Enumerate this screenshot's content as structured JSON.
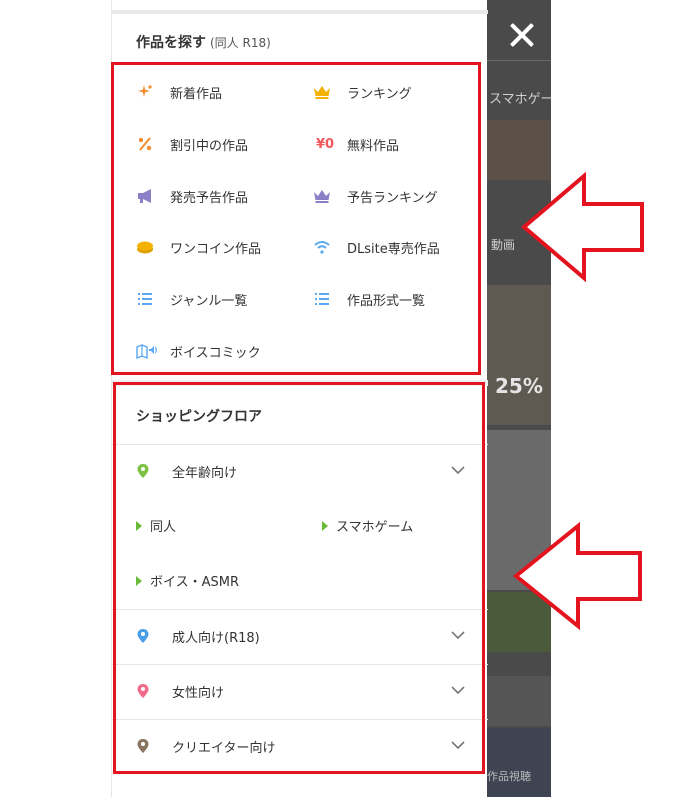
{
  "header": {
    "title": "作品を探す",
    "subtitle": "(同人 R18)"
  },
  "search_items": [
    {
      "label": "新着作品",
      "icon": "sparkle-icon",
      "color": "#f28c2e"
    },
    {
      "label": "ランキング",
      "icon": "crown-icon",
      "color": "#f3b100"
    },
    {
      "label": "割引中の作品",
      "icon": "discount-icon",
      "color": "#f28c2e"
    },
    {
      "label": "無料作品",
      "icon": "yen-zero-icon",
      "color": "#f2585b",
      "glyph": "¥0"
    },
    {
      "label": "発売予告作品",
      "icon": "megaphone-icon",
      "color": "#8b7fc6"
    },
    {
      "label": "予告ランキング",
      "icon": "crown-purple-icon",
      "color": "#8b7fc6"
    },
    {
      "label": "ワンコイン作品",
      "icon": "coin-icon",
      "color": "#f3b100"
    },
    {
      "label": "DLsite専売作品",
      "icon": "wifi-icon",
      "color": "#5aa9f0"
    },
    {
      "label": "ジャンル一覧",
      "icon": "list-icon",
      "color": "#5aa9f0"
    },
    {
      "label": "作品形式一覧",
      "icon": "list-icon",
      "color": "#5aa9f0"
    },
    {
      "label": "ボイスコミック",
      "icon": "voice-comic-icon",
      "color": "#5aa9f0"
    }
  ],
  "shopping_floor": {
    "title": "ショッピングフロア",
    "floors": [
      {
        "label": "全年齢向け",
        "icon": "pin-green-icon",
        "color": "#7cc142"
      },
      {
        "label": "成人向け(R18)",
        "icon": "pin-blue-icon",
        "color": "#4a9ee6"
      },
      {
        "label": "女性向け",
        "icon": "pin-pink-icon",
        "color": "#f26b8a"
      },
      {
        "label": "クリエイター向け",
        "icon": "pin-brown-icon",
        "color": "#8a7560"
      }
    ],
    "all_ages_links": [
      "同人",
      "スマホゲーム",
      "ボイス・ASMR"
    ]
  },
  "background": {
    "fragments": [
      "スマホゲー",
      "動画",
      "25%",
      "作品視聴"
    ]
  },
  "colors": {
    "annotation": "#e3141f",
    "overlay": "#4a4a4a"
  }
}
